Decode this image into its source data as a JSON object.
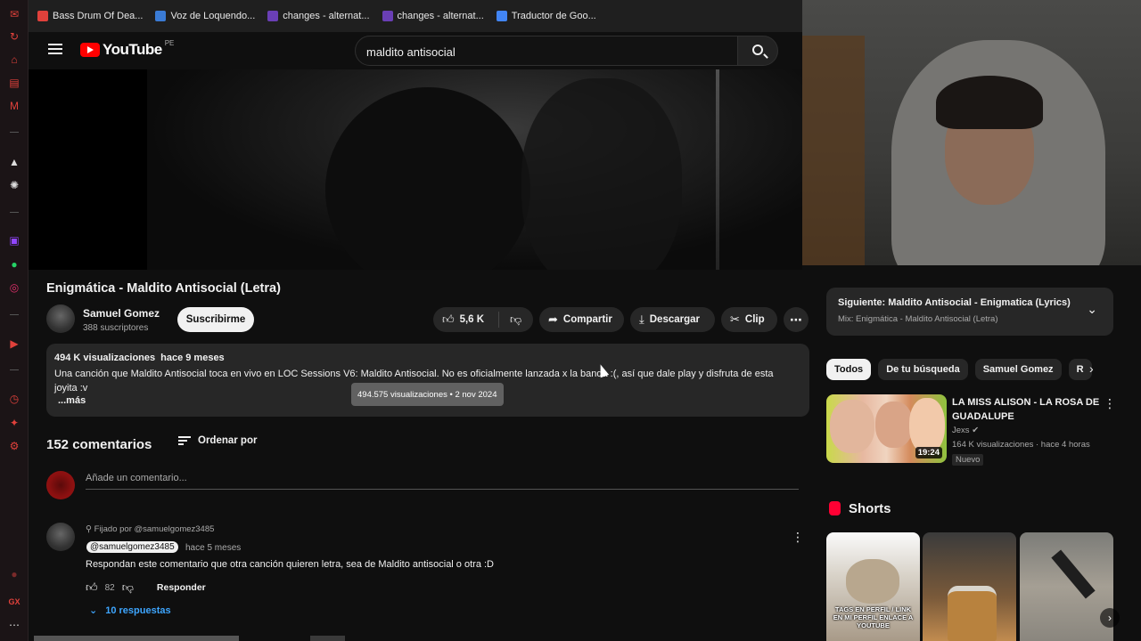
{
  "bookmarks": [
    {
      "label": "Bass Drum Of Dea...",
      "color": "#e0413b"
    },
    {
      "label": "Voz de Loquendo...",
      "color": "#3a7bd5"
    },
    {
      "label": "changes - alternat...",
      "color": "#6a3fb5"
    },
    {
      "label": "changes - alternat...",
      "color": "#6a3fb5"
    },
    {
      "label": "Traductor de Goo...",
      "color": "#4285f4"
    }
  ],
  "header": {
    "logo_text": "YouTube",
    "region": "PE",
    "search_value": "maldito antisocial"
  },
  "video": {
    "title": "Enigmática - Maldito Antisocial (Letra)",
    "channel_name": "Samuel Gomez",
    "subscribers": "388 suscriptores",
    "subscribe_label": "Suscribirme",
    "likes": "5,6 K",
    "share_label": "Compartir",
    "download_label": "Descargar",
    "clip_label": "Clip"
  },
  "description": {
    "views": "494 K visualizaciones",
    "age": "hace 9 meses",
    "text": "Una canción que Maldito Antisocial toca en vivo en LOC Sessions V6: Maldito Antisocial. No es oficialmente lanzada x la banda :(, así que dale play y disfruta de esta joyita :v",
    "more_label": "...más",
    "tooltip": "494.575 visualizaciones • 2 nov 2024"
  },
  "comments": {
    "count": "152 comentarios",
    "sort_label": "Ordenar por",
    "add_placeholder": "Añade un comentario...",
    "pinned": {
      "pinned_by": "Fijado por @samuelgomez3485",
      "author": "@samuelgomez3485",
      "time": "hace 5 meses",
      "text": "Respondan este comentario que otra canción quieren letra, sea de Maldito antisocial o otra :D",
      "likes": "82",
      "reply_label": "Responder",
      "replies_label": "10 respuestas"
    }
  },
  "sidebar": {
    "next": {
      "title": "Siguiente: Maldito Antisocial - Enigmatica (Lyrics)",
      "subtitle": "Mix: Enigmática - Maldito Antisocial (Letra)"
    },
    "chips": [
      "Todos",
      "De tu búsqueda",
      "Samuel Gomez",
      "R"
    ],
    "recommendation": {
      "title": "LA MISS ALISON - LA ROSA DE GUADALUPE",
      "channel": "Jexs",
      "views": "164 K visualizaciones · hace 4 horas",
      "badge": "Nuevo",
      "duration": "19:24"
    },
    "shorts_title": "Shorts",
    "short1_caption": "TAGS EN PERFIL / LINK EN MI PERFIL ENLACE A YOUTUBE"
  },
  "colors": {
    "accent": "#ff0000",
    "link": "#3ea6ff",
    "background": "#0f0f0f"
  }
}
